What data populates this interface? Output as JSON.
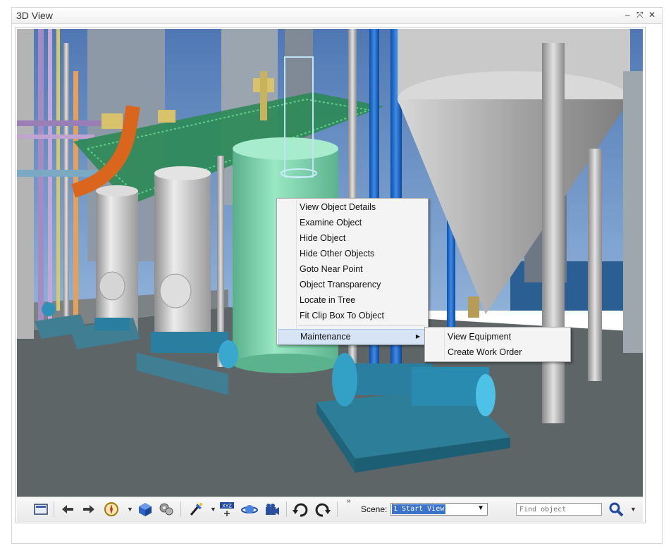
{
  "window": {
    "title": "3D View",
    "minimize_label": "–",
    "maximize_label": "⤧",
    "close_label": "✕"
  },
  "context_menu": {
    "items": [
      {
        "label": "View Object Details"
      },
      {
        "label": "Examine Object"
      },
      {
        "label": "Hide Object"
      },
      {
        "label": "Hide Other Objects"
      },
      {
        "label": "Goto Near Point"
      },
      {
        "label": "Object Transparency"
      },
      {
        "label": "Locate in Tree"
      },
      {
        "label": "Fit Clip Box To Object"
      },
      {
        "label": "Maintenance",
        "submenu": true,
        "highlighted": true
      }
    ],
    "submenu_arrow": "▶",
    "submenu": {
      "items": [
        {
          "label": "View Equipment"
        },
        {
          "label": "Create Work Order"
        }
      ]
    }
  },
  "toolbar": {
    "overflow_label": "»",
    "scene_label": "Scene:",
    "scene_value": "1 Start View",
    "scene_arrow": "▼",
    "find_placeholder": "Find object",
    "dropdown_arrow": "▼",
    "icons": [
      "window-icon",
      "back-arrow-icon",
      "forward-arrow-icon",
      "compass-icon",
      "cube-icon",
      "gears-icon",
      "wand-icon",
      "xyz-coordinates-icon",
      "planet-icon",
      "camera-icon",
      "rotate-left-icon",
      "rotate-right-icon",
      "search-icon"
    ]
  },
  "colors": {
    "accent": "#3a73c9",
    "floor": "#5e6566",
    "sky": "#6f93c2",
    "pump": "#2a7fa0",
    "tank_green": "#7fd8ac",
    "silo": "#c8c8c8"
  }
}
